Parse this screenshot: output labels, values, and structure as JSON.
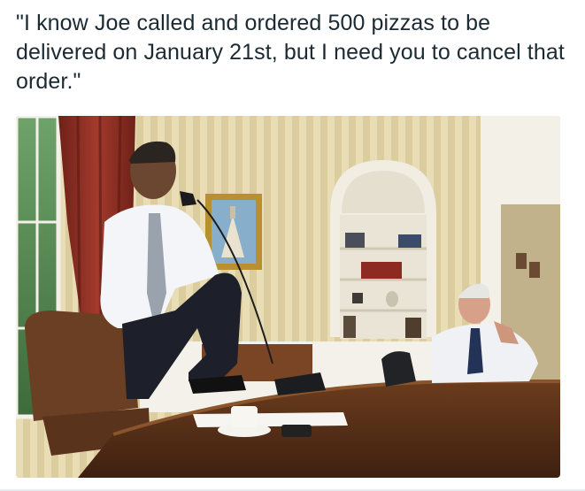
{
  "post": {
    "caption": "\"I know Joe called and ordered 500 pizzas to be delivered on January 21st, but I need you to cancel that order.\"",
    "image_icon": "photo-image"
  },
  "colors": {
    "text": "#1b2a33",
    "wall": "#d8c9a0",
    "curtain": "#8c2f24",
    "desk": "#5a3218",
    "shirt": "#f3f4f7"
  }
}
